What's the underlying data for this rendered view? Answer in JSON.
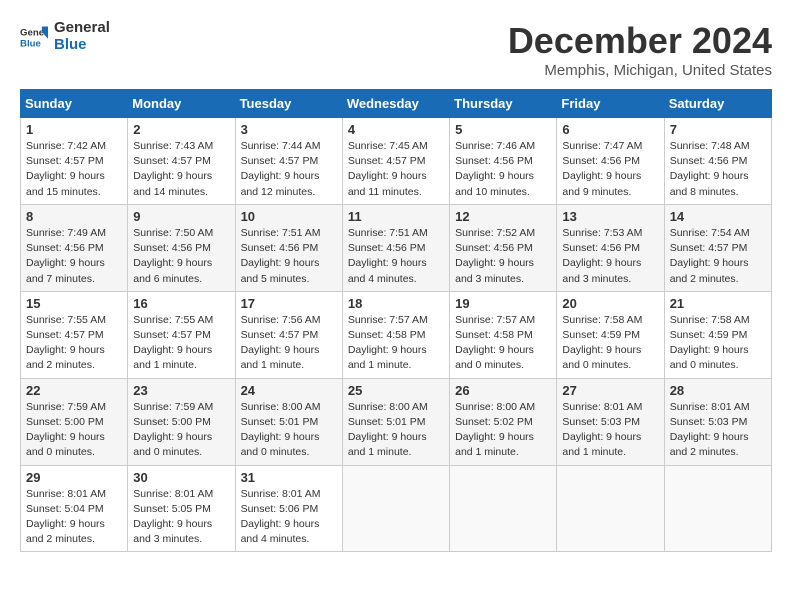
{
  "header": {
    "logo_line1": "General",
    "logo_line2": "Blue",
    "month_title": "December 2024",
    "location": "Memphis, Michigan, United States"
  },
  "weekdays": [
    "Sunday",
    "Monday",
    "Tuesday",
    "Wednesday",
    "Thursday",
    "Friday",
    "Saturday"
  ],
  "weeks": [
    [
      {
        "day": "1",
        "sunrise": "Sunrise: 7:42 AM",
        "sunset": "Sunset: 4:57 PM",
        "daylight": "Daylight: 9 hours and 15 minutes."
      },
      {
        "day": "2",
        "sunrise": "Sunrise: 7:43 AM",
        "sunset": "Sunset: 4:57 PM",
        "daylight": "Daylight: 9 hours and 14 minutes."
      },
      {
        "day": "3",
        "sunrise": "Sunrise: 7:44 AM",
        "sunset": "Sunset: 4:57 PM",
        "daylight": "Daylight: 9 hours and 12 minutes."
      },
      {
        "day": "4",
        "sunrise": "Sunrise: 7:45 AM",
        "sunset": "Sunset: 4:57 PM",
        "daylight": "Daylight: 9 hours and 11 minutes."
      },
      {
        "day": "5",
        "sunrise": "Sunrise: 7:46 AM",
        "sunset": "Sunset: 4:56 PM",
        "daylight": "Daylight: 9 hours and 10 minutes."
      },
      {
        "day": "6",
        "sunrise": "Sunrise: 7:47 AM",
        "sunset": "Sunset: 4:56 PM",
        "daylight": "Daylight: 9 hours and 9 minutes."
      },
      {
        "day": "7",
        "sunrise": "Sunrise: 7:48 AM",
        "sunset": "Sunset: 4:56 PM",
        "daylight": "Daylight: 9 hours and 8 minutes."
      }
    ],
    [
      {
        "day": "8",
        "sunrise": "Sunrise: 7:49 AM",
        "sunset": "Sunset: 4:56 PM",
        "daylight": "Daylight: 9 hours and 7 minutes."
      },
      {
        "day": "9",
        "sunrise": "Sunrise: 7:50 AM",
        "sunset": "Sunset: 4:56 PM",
        "daylight": "Daylight: 9 hours and 6 minutes."
      },
      {
        "day": "10",
        "sunrise": "Sunrise: 7:51 AM",
        "sunset": "Sunset: 4:56 PM",
        "daylight": "Daylight: 9 hours and 5 minutes."
      },
      {
        "day": "11",
        "sunrise": "Sunrise: 7:51 AM",
        "sunset": "Sunset: 4:56 PM",
        "daylight": "Daylight: 9 hours and 4 minutes."
      },
      {
        "day": "12",
        "sunrise": "Sunrise: 7:52 AM",
        "sunset": "Sunset: 4:56 PM",
        "daylight": "Daylight: 9 hours and 3 minutes."
      },
      {
        "day": "13",
        "sunrise": "Sunrise: 7:53 AM",
        "sunset": "Sunset: 4:56 PM",
        "daylight": "Daylight: 9 hours and 3 minutes."
      },
      {
        "day": "14",
        "sunrise": "Sunrise: 7:54 AM",
        "sunset": "Sunset: 4:57 PM",
        "daylight": "Daylight: 9 hours and 2 minutes."
      }
    ],
    [
      {
        "day": "15",
        "sunrise": "Sunrise: 7:55 AM",
        "sunset": "Sunset: 4:57 PM",
        "daylight": "Daylight: 9 hours and 2 minutes."
      },
      {
        "day": "16",
        "sunrise": "Sunrise: 7:55 AM",
        "sunset": "Sunset: 4:57 PM",
        "daylight": "Daylight: 9 hours and 1 minute."
      },
      {
        "day": "17",
        "sunrise": "Sunrise: 7:56 AM",
        "sunset": "Sunset: 4:57 PM",
        "daylight": "Daylight: 9 hours and 1 minute."
      },
      {
        "day": "18",
        "sunrise": "Sunrise: 7:57 AM",
        "sunset": "Sunset: 4:58 PM",
        "daylight": "Daylight: 9 hours and 1 minute."
      },
      {
        "day": "19",
        "sunrise": "Sunrise: 7:57 AM",
        "sunset": "Sunset: 4:58 PM",
        "daylight": "Daylight: 9 hours and 0 minutes."
      },
      {
        "day": "20",
        "sunrise": "Sunrise: 7:58 AM",
        "sunset": "Sunset: 4:59 PM",
        "daylight": "Daylight: 9 hours and 0 minutes."
      },
      {
        "day": "21",
        "sunrise": "Sunrise: 7:58 AM",
        "sunset": "Sunset: 4:59 PM",
        "daylight": "Daylight: 9 hours and 0 minutes."
      }
    ],
    [
      {
        "day": "22",
        "sunrise": "Sunrise: 7:59 AM",
        "sunset": "Sunset: 5:00 PM",
        "daylight": "Daylight: 9 hours and 0 minutes."
      },
      {
        "day": "23",
        "sunrise": "Sunrise: 7:59 AM",
        "sunset": "Sunset: 5:00 PM",
        "daylight": "Daylight: 9 hours and 0 minutes."
      },
      {
        "day": "24",
        "sunrise": "Sunrise: 8:00 AM",
        "sunset": "Sunset: 5:01 PM",
        "daylight": "Daylight: 9 hours and 0 minutes."
      },
      {
        "day": "25",
        "sunrise": "Sunrise: 8:00 AM",
        "sunset": "Sunset: 5:01 PM",
        "daylight": "Daylight: 9 hours and 1 minute."
      },
      {
        "day": "26",
        "sunrise": "Sunrise: 8:00 AM",
        "sunset": "Sunset: 5:02 PM",
        "daylight": "Daylight: 9 hours and 1 minute."
      },
      {
        "day": "27",
        "sunrise": "Sunrise: 8:01 AM",
        "sunset": "Sunset: 5:03 PM",
        "daylight": "Daylight: 9 hours and 1 minute."
      },
      {
        "day": "28",
        "sunrise": "Sunrise: 8:01 AM",
        "sunset": "Sunset: 5:03 PM",
        "daylight": "Daylight: 9 hours and 2 minutes."
      }
    ],
    [
      {
        "day": "29",
        "sunrise": "Sunrise: 8:01 AM",
        "sunset": "Sunset: 5:04 PM",
        "daylight": "Daylight: 9 hours and 2 minutes."
      },
      {
        "day": "30",
        "sunrise": "Sunrise: 8:01 AM",
        "sunset": "Sunset: 5:05 PM",
        "daylight": "Daylight: 9 hours and 3 minutes."
      },
      {
        "day": "31",
        "sunrise": "Sunrise: 8:01 AM",
        "sunset": "Sunset: 5:06 PM",
        "daylight": "Daylight: 9 hours and 4 minutes."
      },
      null,
      null,
      null,
      null
    ]
  ]
}
